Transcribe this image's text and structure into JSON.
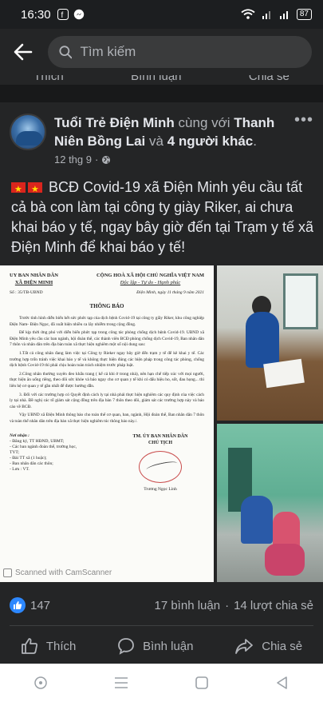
{
  "status_bar": {
    "time": "16:30",
    "battery": "87"
  },
  "search": {
    "placeholder": "Tìm kiếm"
  },
  "previous_post_actions": {
    "like": "Thích",
    "comment": "Bình luận",
    "share": "Chia sẻ"
  },
  "post": {
    "author": "Tuổi Trẻ Điện Minh",
    "with_text": "cùng với",
    "tagged": "Thanh Niên Bồng Lai",
    "and_text": "và",
    "others": "4 người khác",
    "date": "12 thg 9",
    "privacy_icon": "globe-icon",
    "body": "BCĐ Covid-19 xã Điện Minh yêu cầu tất cả bà con làm tại công ty giày Riker, ai chưa khai báo y tế, ngay bây giờ đến tại Trạm y tế xã Điện Minh để khai báo y tế!",
    "reactions_count": "147",
    "comments": "17 bình luận",
    "shares": "14 lượt chia sẻ"
  },
  "document": {
    "left_header_1": "UY BAN NHÂN DÂN",
    "left_header_2": "XÃ ĐIỆN MINH",
    "right_header_1": "CỘNG HOÀ XÃ HỘI CHỦ NGHĨA VIỆT NAM",
    "right_header_2": "Độc lập - Tự do - Hạnh phúc",
    "number": "Số : 35/TB-UBND",
    "date_place": "Điện Minh, ngày 11 tháng 9 năm 2021",
    "title": "THÔNG BÁO",
    "paragraphs": [
      "Trước tình hình diễn biến hết sức phức tạp của dịch bệnh Covid-19 tại công ty giầy Riker, khu công nghiệp Điện Nam- Điện Ngọc, đã xuất hiện nhiều ca lây nhiễm trong cộng đồng.",
      "Để kịp thời ứng phó với diễn biến phức tạp trong công tác phòng chống dịch bệnh Covid-19. UBND xã Điện Minh yêu cầu các ban ngành, hội đoàn thể, các thành viên BCĐ phòng chống dịch Covid-19, Ban nhân dân 7 thôn và nhân dân trên địa bàn toàn xã thực hiện nghiêm một số nội dung sau:",
      "1.Tất cả công nhân đang làm việc tại Công ty Rieker ngay bây giờ đến trạm y tế để kê khai y tế. Các trường hợp trốn tránh việc khai báo y tế và không thực hiện đúng các biện pháp trong công tác phòng, chống dịch bệnh Covid-19 thì phải chịu hoàn toàn trách nhiệm trước pháp luật.",
      "2.Công nhân thường xuyên đeo khẩu trang ( kể cả khi ở trong nhà), nên hạn chế tiếp xúc với mọi người, thực hiện ăn uống riêng, theo dõi sức khỏe và báo ngay cho cơ quan y tế khi có dấu hiệu ho, sốt, đau họng... thì liên hệ cơ quan y tế gần nhất để được hướng dẫn.",
      "3. Đối với các trường hợp có Quyết định cách ly tại nhà phải thực hiện nghiêm các quy định của việc cách ly tại nhà. Đề nghị các tổ giám sát cộng đồng trên địa bàn 7 thôn theo dõi, giám sát các trường hợp này và báo cáo về BCĐ.",
      "Vậy UBND xã Điện Minh thông báo cho toàn thể cơ quan, ban, ngành, Hội đoàn thể, Ban nhân dân 7 thôn và toàn thể nhân dân trên địa bàn xã thực hiện nghiêm túc thông báo này./."
    ],
    "recipients_title": "Nơi nhận :",
    "recipients": [
      "- Đăng ký, TT HĐND, UBMT;",
      "- Các ban ngành đoàn thể, trường học, TYT;",
      "- Đài TT xã (1 hoặc);",
      "- Ban nhân dân các thôn;",
      "- Lưu : VT."
    ],
    "signer_org": "TM. ỦY BAN NHÂN DÂN",
    "signer_role": "CHỦ TỊCH",
    "signer_name": "Trương Ngọc Linh",
    "watermark": "Scanned with CamScanner"
  },
  "actions": {
    "like": "Thích",
    "comment": "Bình luận",
    "share": "Chia sẻ"
  }
}
